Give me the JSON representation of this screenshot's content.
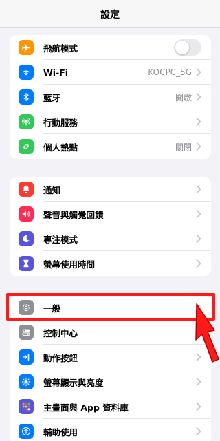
{
  "nav": {
    "title": "設定"
  },
  "groups": [
    {
      "items": [
        {
          "label": "飛航模式",
          "value": "",
          "icon": "airplane-icon",
          "color": "#ff9500",
          "control": "toggle"
        },
        {
          "label": "Wi-Fi",
          "value": "KOCPC_5G",
          "icon": "wifi-icon",
          "color": "#007aff",
          "control": "chevron"
        },
        {
          "label": "藍牙",
          "value": "開啟",
          "icon": "bluetooth-icon",
          "color": "#007aff",
          "control": "chevron"
        },
        {
          "label": "行動服務",
          "value": "",
          "icon": "cellular-icon",
          "color": "#34c759",
          "control": "chevron"
        },
        {
          "label": "個人熱點",
          "value": "關閉",
          "icon": "hotspot-icon",
          "color": "#34c759",
          "control": "chevron"
        }
      ]
    },
    {
      "items": [
        {
          "label": "通知",
          "value": "",
          "icon": "bell-icon",
          "color": "#ff3b30",
          "control": "chevron"
        },
        {
          "label": "聲音與觸覺回饋",
          "value": "",
          "icon": "speaker-icon",
          "color": "#ff2d55",
          "control": "chevron"
        },
        {
          "label": "專注模式",
          "value": "",
          "icon": "moon-icon",
          "color": "#5856d6",
          "control": "chevron"
        },
        {
          "label": "螢幕使用時間",
          "value": "",
          "icon": "hourglass-icon",
          "color": "#5856d6",
          "control": "chevron"
        }
      ]
    },
    {
      "items": [
        {
          "label": "一般",
          "value": "",
          "icon": "gear-icon",
          "color": "#8e8e93",
          "control": "chevron"
        },
        {
          "label": "控制中心",
          "value": "",
          "icon": "toggles-icon",
          "color": "#8e8e93",
          "control": "chevron"
        },
        {
          "label": "動作按鈕",
          "value": "",
          "icon": "action-button-icon",
          "color": "#007aff",
          "control": "chevron"
        },
        {
          "label": "螢幕顯示與亮度",
          "value": "",
          "icon": "sun-icon",
          "color": "#007aff",
          "control": "chevron"
        },
        {
          "label": "主畫面與 App 資料庫",
          "value": "",
          "icon": "app-grid-icon",
          "color": "#5856d6",
          "control": "chevron"
        },
        {
          "label": "輔助使用",
          "value": "",
          "icon": "accessibility-icon",
          "color": "#007aff",
          "control": "chevron"
        }
      ]
    }
  ],
  "annotation": {
    "highlight_color": "#ff1a1a"
  }
}
